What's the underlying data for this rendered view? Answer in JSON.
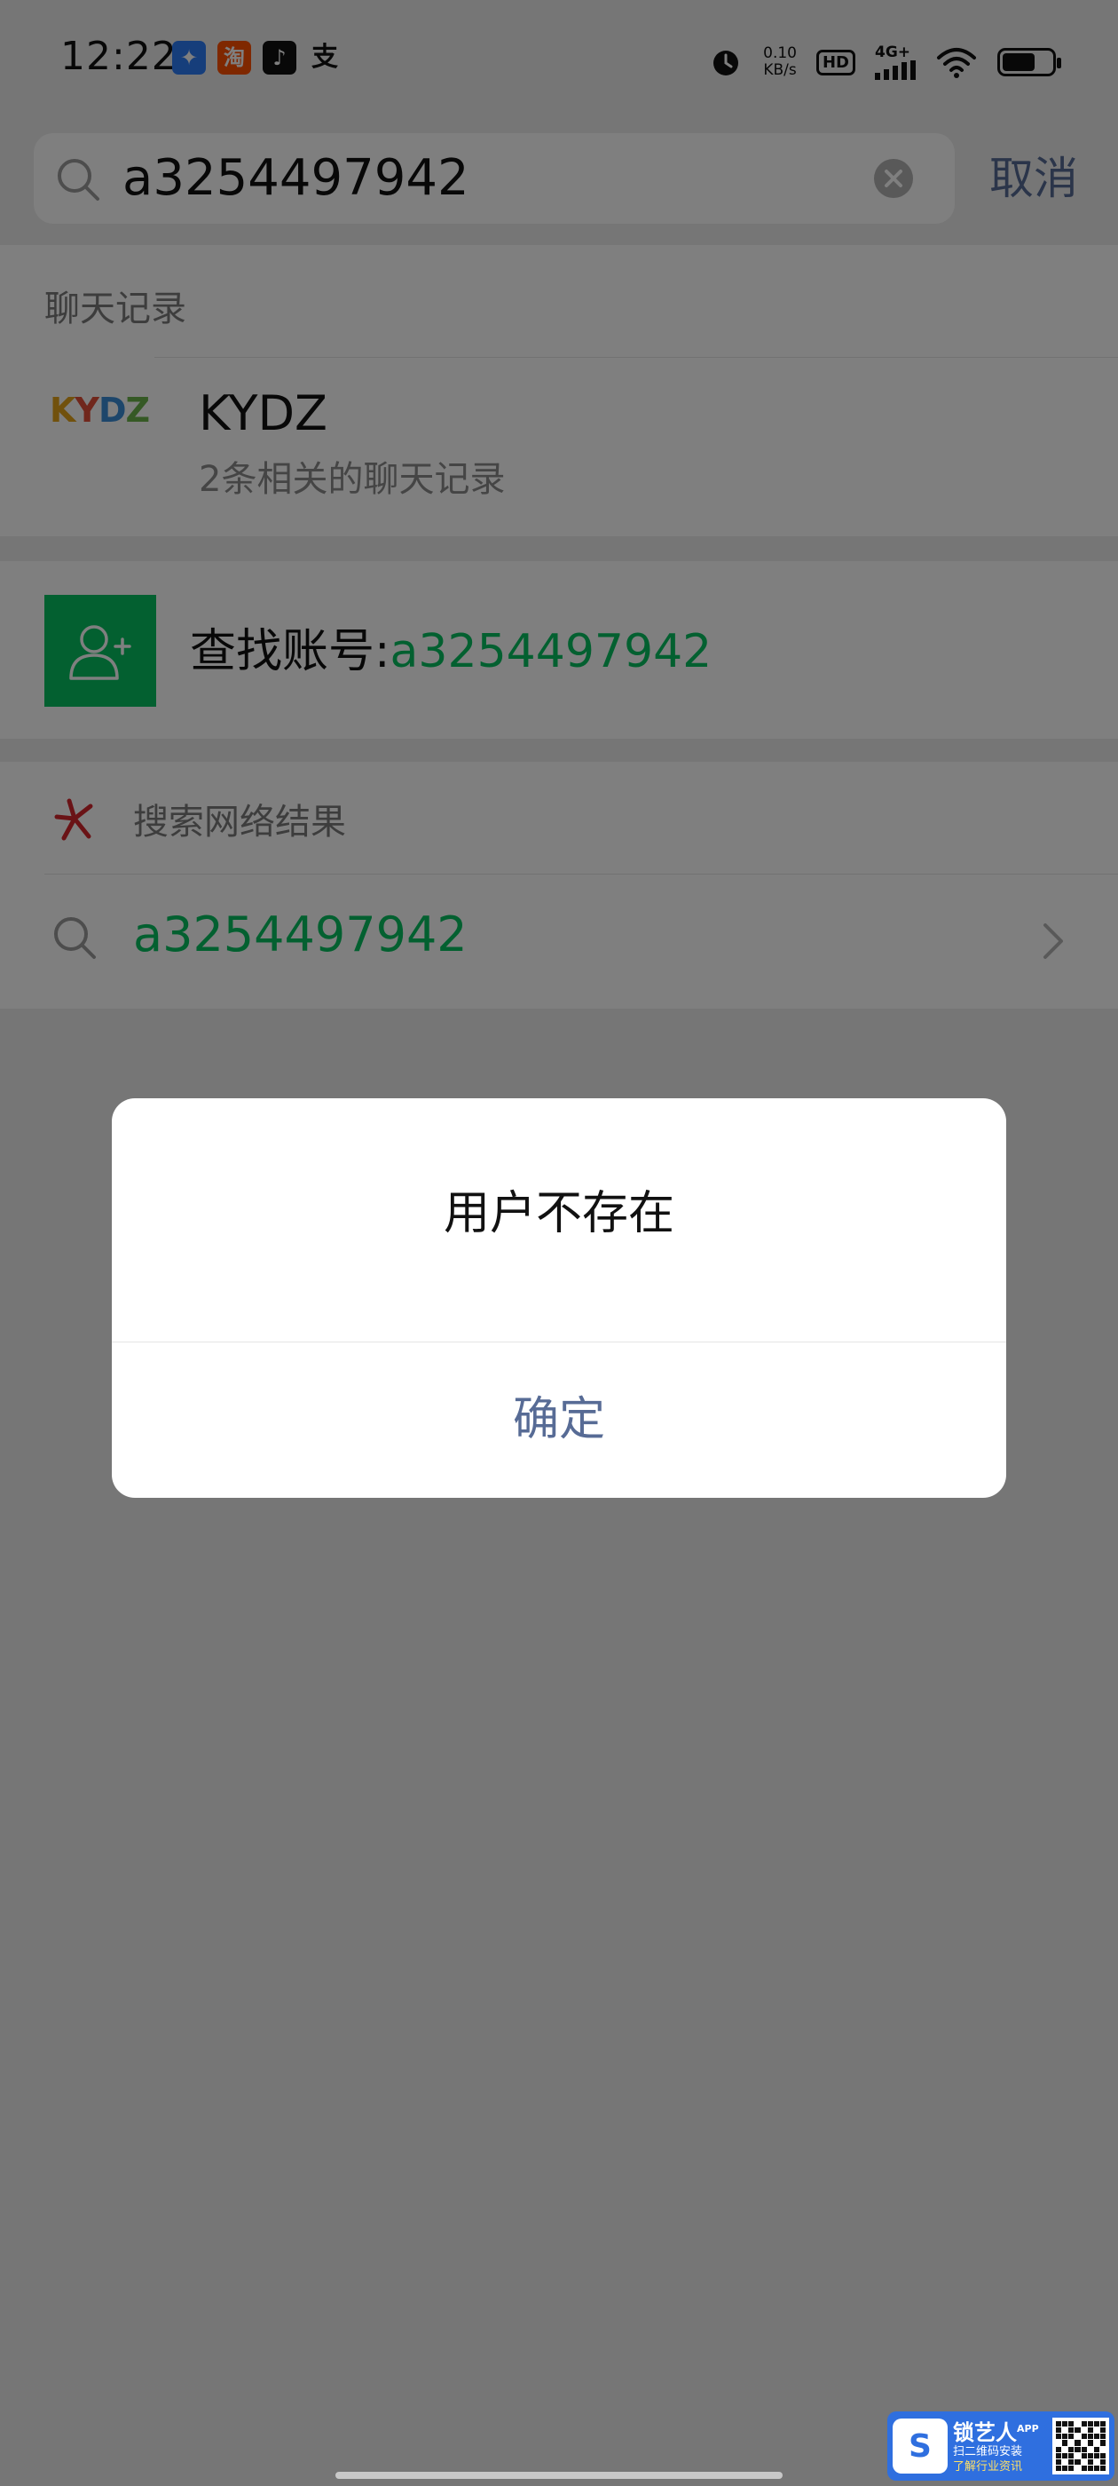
{
  "status_bar": {
    "time": "12:22",
    "net_speed_value": "0.10",
    "net_speed_unit": "KB/s",
    "hd": "HD",
    "network": "4G+",
    "app_icons": [
      "baidu-icon",
      "taobao-icon",
      "tiktok-icon",
      "alipay-icon"
    ]
  },
  "search": {
    "query": "a3254497942",
    "cancel_label": "取消"
  },
  "chat_records": {
    "section_title": "聊天记录",
    "item": {
      "avatar_text": "KYDZ",
      "name": "KYDZ",
      "subtitle": "2条相关的聊天记录"
    }
  },
  "find_account": {
    "label": "查找账号:",
    "value": "a3254497942"
  },
  "web_results": {
    "section_title": "搜索网络结果",
    "query": "a3254497942"
  },
  "dialog": {
    "message": "用户不存在",
    "confirm_label": "确定"
  },
  "watermark": {
    "name": "锁艺人",
    "tag": "APP",
    "line1": "扫二维码安装",
    "line2": "了解行业资讯"
  },
  "colors": {
    "accent_green": "#07c160",
    "link_blue": "#576b95"
  }
}
